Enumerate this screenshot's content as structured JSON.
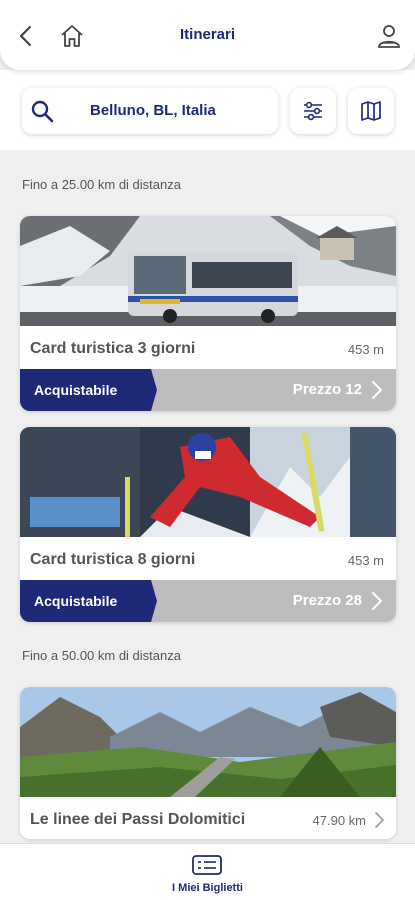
{
  "header": {
    "title": "Itinerari"
  },
  "search": {
    "location": "Belluno, BL, Italia"
  },
  "sections": [
    {
      "label": "Fino a 25.00 km di distanza"
    },
    {
      "label": "Fino a 50.00 km di distanza"
    }
  ],
  "cards": [
    {
      "name": "Card turistica 3 giorni",
      "distance": "453 m",
      "badge": "Acquistabile",
      "price": "Prezzo 12"
    },
    {
      "name": "Card turistica 8 giorni",
      "distance": "453 m",
      "badge": "Acquistabile",
      "price": "Prezzo 28"
    },
    {
      "name": "Le linee dei Passi Dolomitici",
      "distance": "47.90 km"
    }
  ],
  "bottom_nav": {
    "label": "I Miei Biglietti"
  },
  "colors": {
    "primary": "#1e2a78",
    "bar_gray": "#bdbdbf",
    "background": "#efefef"
  }
}
